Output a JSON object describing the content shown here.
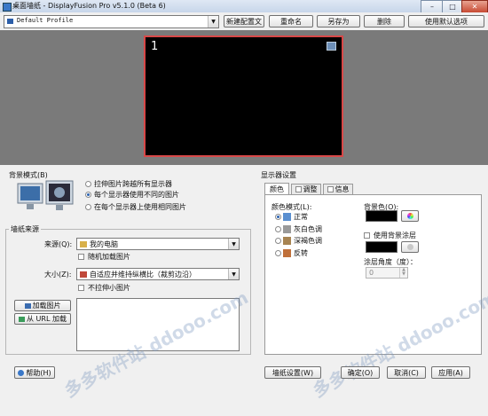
{
  "window": {
    "title": "桌面墙纸 - DisplayFusion Pro v5.1.0 (Beta 6)",
    "min": "–",
    "max": "□",
    "close": "✕"
  },
  "toolbar": {
    "profile_value": "Default Profile",
    "buttons": [
      "新建配置文",
      "重命名",
      "另存为",
      "删除",
      "使用默认选项"
    ]
  },
  "monitor": {
    "number": "1"
  },
  "bg_mode": {
    "title": "背景模式(B)",
    "options": [
      "拉伸图片跨越所有显示器",
      "每个显示器使用不同的图片",
      "在每个显示器上使用相同图片"
    ],
    "selected": 1
  },
  "source": {
    "title": "墙纸来源",
    "source_label": "来源(Q):",
    "source_value": "我的电脑",
    "random_label": "随机加载图片",
    "size_label": "大小(Z):",
    "size_value": "自适应并维持纵横比（裁剪边沿）",
    "no_stretch_label": "不拉伸小图片",
    "load_button": "加载图片",
    "url_button": "从 URL 加载"
  },
  "monitor_settings": {
    "title": "显示器设置",
    "tabs": [
      "颜色",
      "调整",
      "信息"
    ],
    "color_mode_label": "颜色模式(L):",
    "color_modes": [
      "正常",
      "灰白色调",
      "深褐色调",
      "反转"
    ],
    "selected_mode": 0,
    "bg_color_label": "背景色(O):",
    "use_bg_layer_label": "使用背景涂层",
    "angle_label": "涂层角度（度）：",
    "angle_value": "0",
    "accent": "#000000"
  },
  "bottom": {
    "help": "帮助(H)",
    "wallpaper_settings": "墙纸设置(W)",
    "ok": "确定(O)",
    "cancel": "取消(C)",
    "apply": "应用(A)"
  },
  "watermark": "多多软件站  ddooo.com"
}
